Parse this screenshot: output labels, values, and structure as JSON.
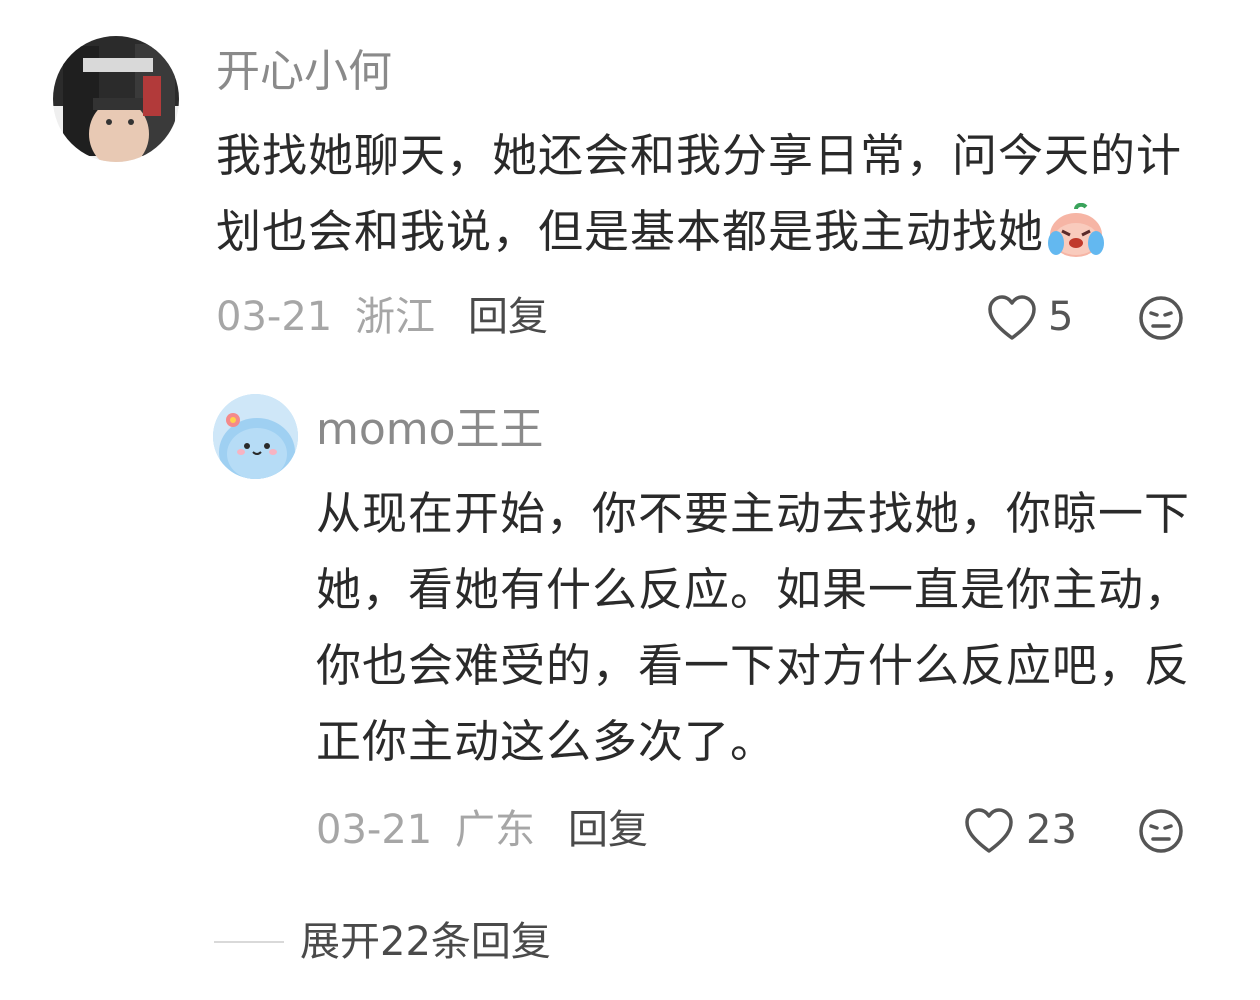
{
  "comment": {
    "author": "开心小何",
    "text": "我找她聊天，她还会和我分享日常，问今天的计划也会和我说，但是基本都是我主动找她",
    "date": "03-21",
    "location": "浙江",
    "reply_label": "回复",
    "likes": "5",
    "emoji_icon": "crying-face-icon"
  },
  "reply": {
    "author": "momo王王",
    "text": "从现在开始，你不要主动去找她，你晾一下她，看她有什么反应。如果一直是你主动，你也会难受的，看一下对方什么反应吧，反正你主动这么多次了。",
    "date": "03-21",
    "location": "广东",
    "reply_label": "回复",
    "likes": "23"
  },
  "expand_label": "展开22条回复",
  "colors": {
    "name": "#8a8a8a",
    "text": "#2a2a2a",
    "meta": "#a6a6a6",
    "accent_avatar2": "#b9dcf3"
  }
}
